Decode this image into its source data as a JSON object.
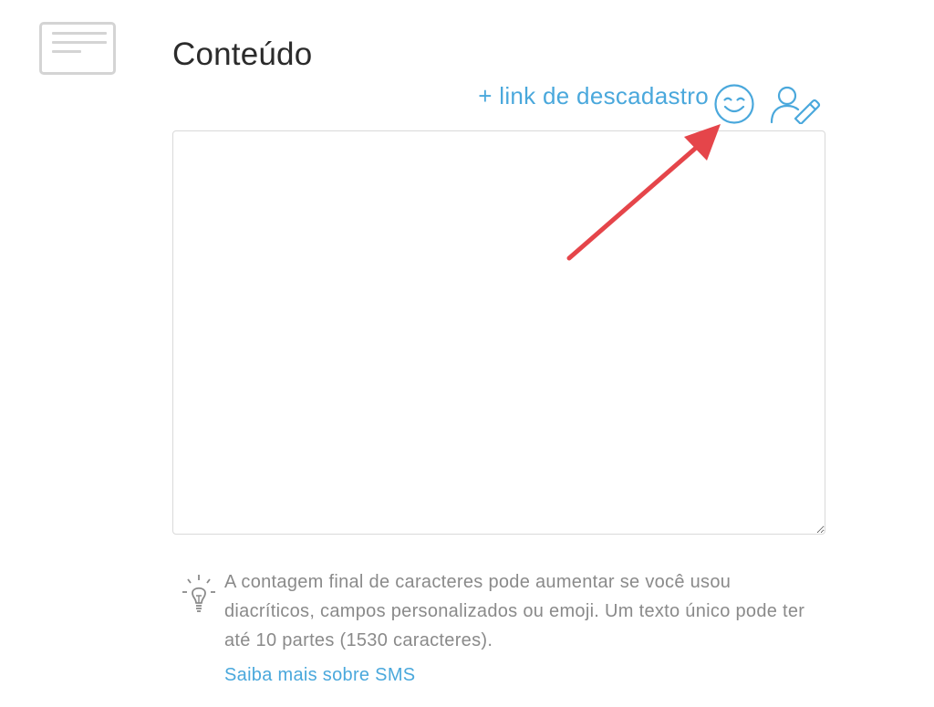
{
  "section": {
    "title": "Conteúdo",
    "icon": "message-card-icon"
  },
  "toolbar": {
    "unsubscribe_link": "+ link de descadastro",
    "emoji_icon": "smiley-face-icon",
    "personalize_icon": "person-pencil-icon"
  },
  "editor": {
    "value": "",
    "placeholder": ""
  },
  "tip": {
    "icon": "lightbulb-icon",
    "text": "A contagem final de caracteres pode aumentar se você usou diacríticos, campos personalizados ou emoji. Um texto único pode ter até 10 partes (1530 caracteres).",
    "link": "Saiba mais sobre SMS"
  },
  "colors": {
    "accent": "#4aa8dc",
    "title": "#2b2b2b",
    "muted_text": "#8a8a8a",
    "icon_gray": "#d4d4d4",
    "annotation_arrow": "#e5454a"
  }
}
